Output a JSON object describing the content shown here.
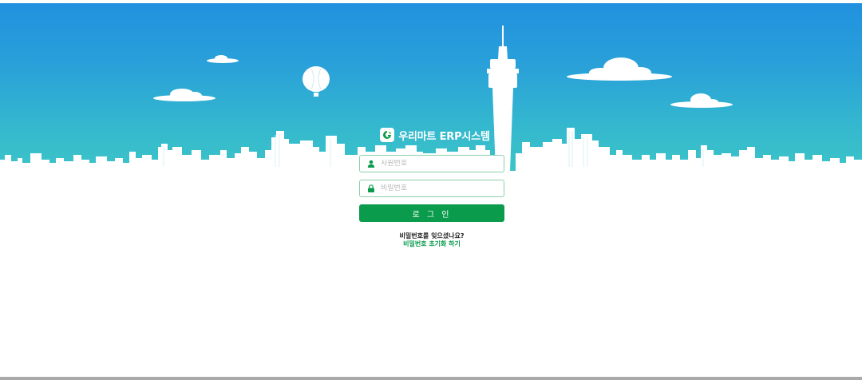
{
  "brand": {
    "title": "우리마트 ERP시스템",
    "logo_icon": "leaf-logo-icon"
  },
  "form": {
    "employee_id": {
      "placeholder": "사원번호",
      "value": "",
      "icon": "user-icon"
    },
    "password": {
      "placeholder": "비밀번호",
      "value": "",
      "icon": "lock-icon"
    },
    "login_label": "로 그 인"
  },
  "help": {
    "question": "비밀번호를 잊으셨나요?",
    "reset_link": "비밀번호 초기화 하기"
  },
  "colors": {
    "sky_top": "#2191df",
    "sky_bottom": "#3cc4c8",
    "accent": "#0a9b4c",
    "field_border": "#8ccfab"
  }
}
